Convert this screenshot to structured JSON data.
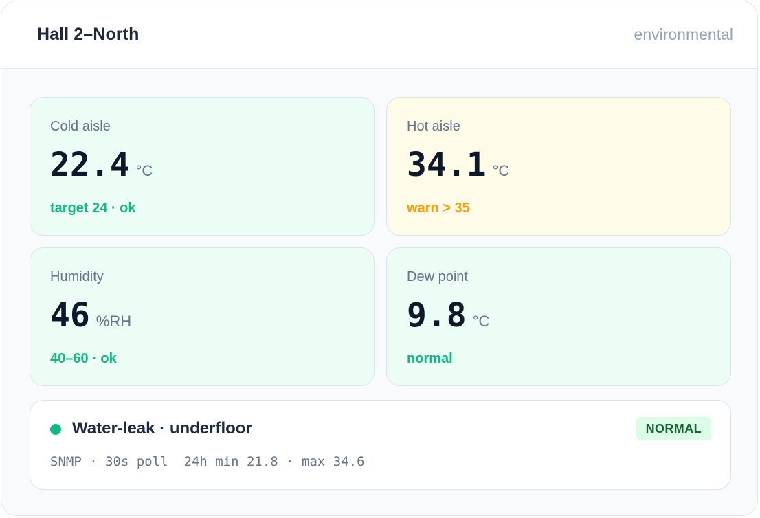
{
  "header": {
    "title": "Hall 2–North",
    "subtitle": "environmental"
  },
  "tiles": [
    {
      "label": "Cold aisle",
      "value": "22.4",
      "unit": "°C",
      "status": "target 24 · ok",
      "state": "ok"
    },
    {
      "label": "Hot aisle",
      "value": "34.1",
      "unit": "°C",
      "status": "warn > 35",
      "state": "warn"
    },
    {
      "label": "Humidity",
      "value": "46",
      "unit": "%RH",
      "status": "40–60 · ok",
      "state": "ok"
    },
    {
      "label": "Dew point",
      "value": "9.8",
      "unit": "°C",
      "status": "normal",
      "state": "ok"
    }
  ],
  "leak": {
    "title": "Water-leak · underfloor",
    "badge": "NORMAL",
    "meta": "SNMP · 30s poll  24h min 21.8 · max 34.6",
    "indicator_icon": "status-dot-icon"
  },
  "colors": {
    "ok_bg": "#ecfdf5",
    "warn_bg": "#fefce8",
    "ok_text": "#10b981",
    "warn_text": "#f59e0b",
    "badge_bg": "#dcfce7",
    "badge_text": "#166534"
  }
}
